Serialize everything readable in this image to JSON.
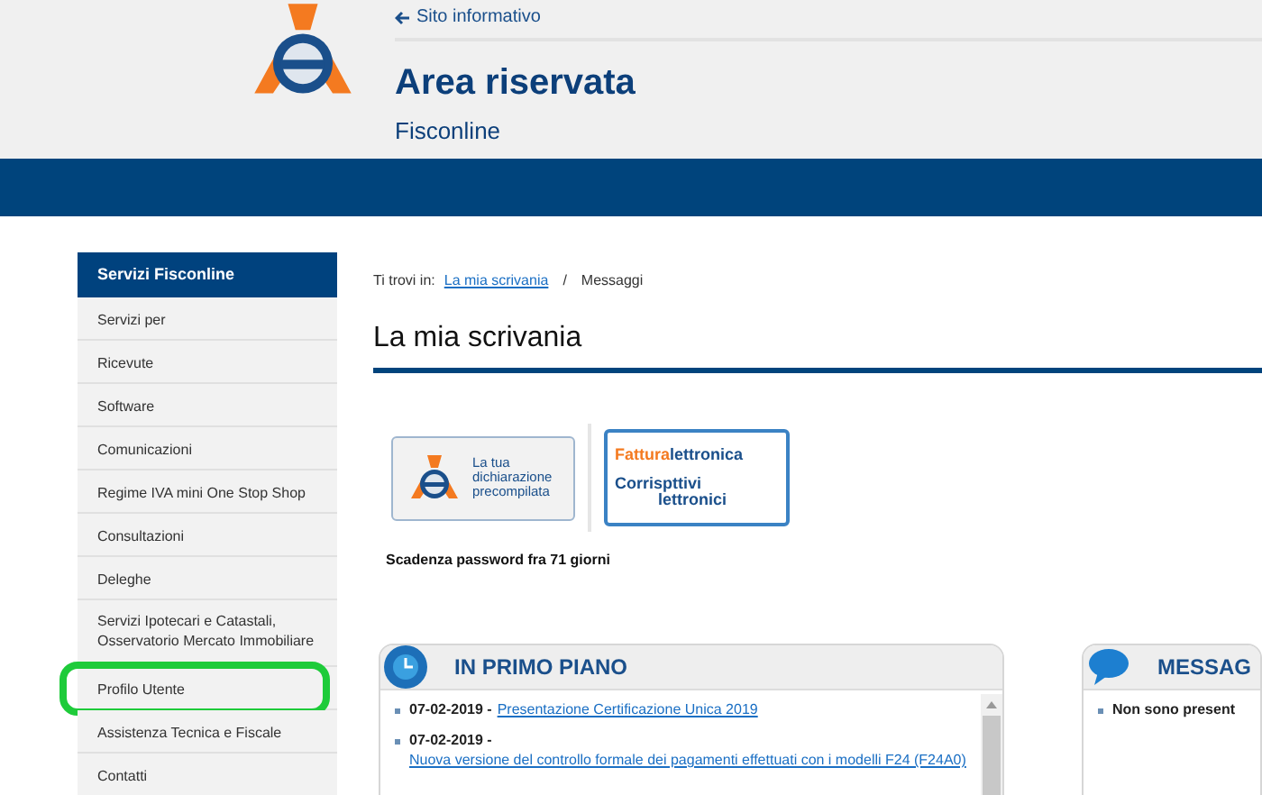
{
  "header": {
    "back_link": "Sito informativo",
    "title": "Area riservata",
    "subtitle": "Fisconline"
  },
  "sidebar": {
    "title": "Servizi Fisconline",
    "items": [
      {
        "label": "Servizi per",
        "highlighted": false
      },
      {
        "label": "Ricevute",
        "highlighted": false
      },
      {
        "label": "Software",
        "highlighted": false
      },
      {
        "label": "Comunicazioni",
        "highlighted": false
      },
      {
        "label": "Regime IVA mini One Stop Shop",
        "highlighted": false
      },
      {
        "label": "Consultazioni",
        "highlighted": false
      },
      {
        "label": "Deleghe",
        "highlighted": false
      },
      {
        "label": "Servizi Ipotecari e Catastali, Osservatorio Mercato Immobiliare",
        "highlighted": false
      },
      {
        "label": "Profilo Utente",
        "highlighted": true
      },
      {
        "label": "Assistenza Tecnica e Fiscale",
        "highlighted": false
      },
      {
        "label": "Contatti",
        "highlighted": false
      }
    ]
  },
  "breadcrumb": {
    "prefix": "Ti trovi in:",
    "link": "La mia scrivania",
    "separator": "/",
    "current": "Messaggi"
  },
  "page_title": "La mia scrivania",
  "tiles": [
    {
      "kind": "precompilata",
      "lines": [
        "La tua",
        "dichiarazione",
        "precompilata"
      ]
    },
    {
      "kind": "fattura",
      "lines": [
        "Fattura",
        "lettronica",
        "Corrisp",
        "ttivi",
        "lettronici"
      ]
    }
  ],
  "password_notice": "Scadenza password fra 71 giorni",
  "panels": [
    {
      "kind": "news",
      "title": "IN PRIMO PIANO",
      "items": [
        {
          "date": "07-02-2019 -",
          "link": "Presentazione Certificazione Unica 2019"
        },
        {
          "date": "07-02-2019 -",
          "link": "Nuova versione del controllo formale dei pagamenti effettuati con i modelli F24 (F24A0)"
        }
      ]
    },
    {
      "kind": "messages",
      "title": "MESSAG",
      "items": [
        {
          "text": "Non sono present"
        }
      ]
    }
  ]
}
